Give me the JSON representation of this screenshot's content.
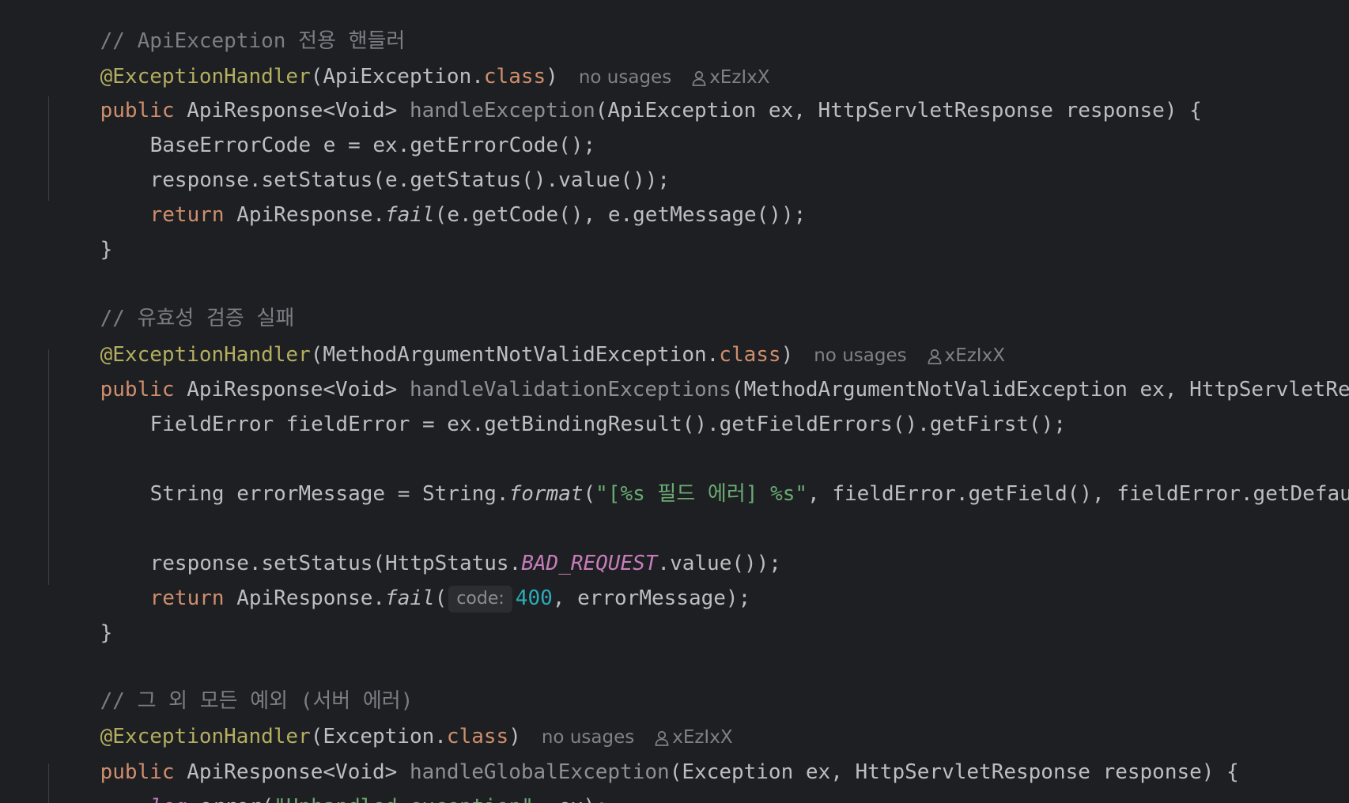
{
  "code": {
    "block1": {
      "comment": "// ApiException 전용 핸들러",
      "annotation": "@ExceptionHandler",
      "annotation_arg": "(ApiException.",
      "class_kw": "class",
      "annotation_close": ")",
      "usages": "no usages",
      "author": "xEzIxX",
      "sig_public": "public",
      "sig_type": " ApiResponse<Void> ",
      "sig_method": "handleException",
      "sig_params": "(ApiException ex, HttpServletResponse response) {",
      "body1": "BaseErrorCode e = ex.getErrorCode();",
      "body2": "response.setStatus(e.getStatus().value());",
      "body3_return": "return",
      "body3_a": " ApiResponse.",
      "body3_fail": "fail",
      "body3_b": "(e.getCode(), e.getMessage());",
      "close": "}"
    },
    "block2": {
      "comment": "// 유효성 검증 실패",
      "annotation": "@ExceptionHandler",
      "annotation_arg": "(MethodArgumentNotValidException.",
      "class_kw": "class",
      "annotation_close": ")",
      "usages": "no usages",
      "author": "xEzIxX",
      "sig_public": "public",
      "sig_type": " ApiResponse<Void> ",
      "sig_method": "handleValidationExceptions",
      "sig_params": "(MethodArgumentNotValidException ex, HttpServletRespons",
      "body1": "FieldError fieldError = ex.getBindingResult().getFieldErrors().getFirst();",
      "body2_a": "String errorMessage = String.",
      "body2_format": "format",
      "body2_paren": "(",
      "body2_str": "\"[%s 필드 에러] %s\"",
      "body2_b": ", fieldError.getField(), fieldError.getDefaultMes",
      "body3_a": "response.setStatus(HttpStatus.",
      "body3_const": "BAD_REQUEST",
      "body3_b": ".value());",
      "body4_return": "return",
      "body4_a": " ApiResponse.",
      "body4_fail": "fail",
      "body4_paren": "(",
      "body4_hint": "code:",
      "body4_num": "400",
      "body4_b": ", errorMessage);",
      "close": "}"
    },
    "block3": {
      "comment": "// 그 외 모든 예외 (서버 에러)",
      "annotation": "@ExceptionHandler",
      "annotation_arg": "(Exception.",
      "class_kw": "class",
      "annotation_close": ")",
      "usages": "no usages",
      "author": "xEzIxX",
      "sig_public": "public",
      "sig_type": " ApiResponse<Void> ",
      "sig_method": "handleGlobalException",
      "sig_params": "(Exception ex, HttpServletResponse response) {",
      "body1_log": "log",
      "body1_a": ".error(",
      "body1_str": "\"Unhandled exception\"",
      "body1_b": ", ex);"
    }
  },
  "colors": {
    "background": "#1e1f22",
    "text": "#bcbec4",
    "comment": "#7a7e85",
    "annotation": "#b3ae60",
    "keyword": "#cf8e6d",
    "string": "#6aab73",
    "number": "#2aacb8",
    "constant": "#c77dbb"
  },
  "icons": {
    "author": "user-icon"
  }
}
